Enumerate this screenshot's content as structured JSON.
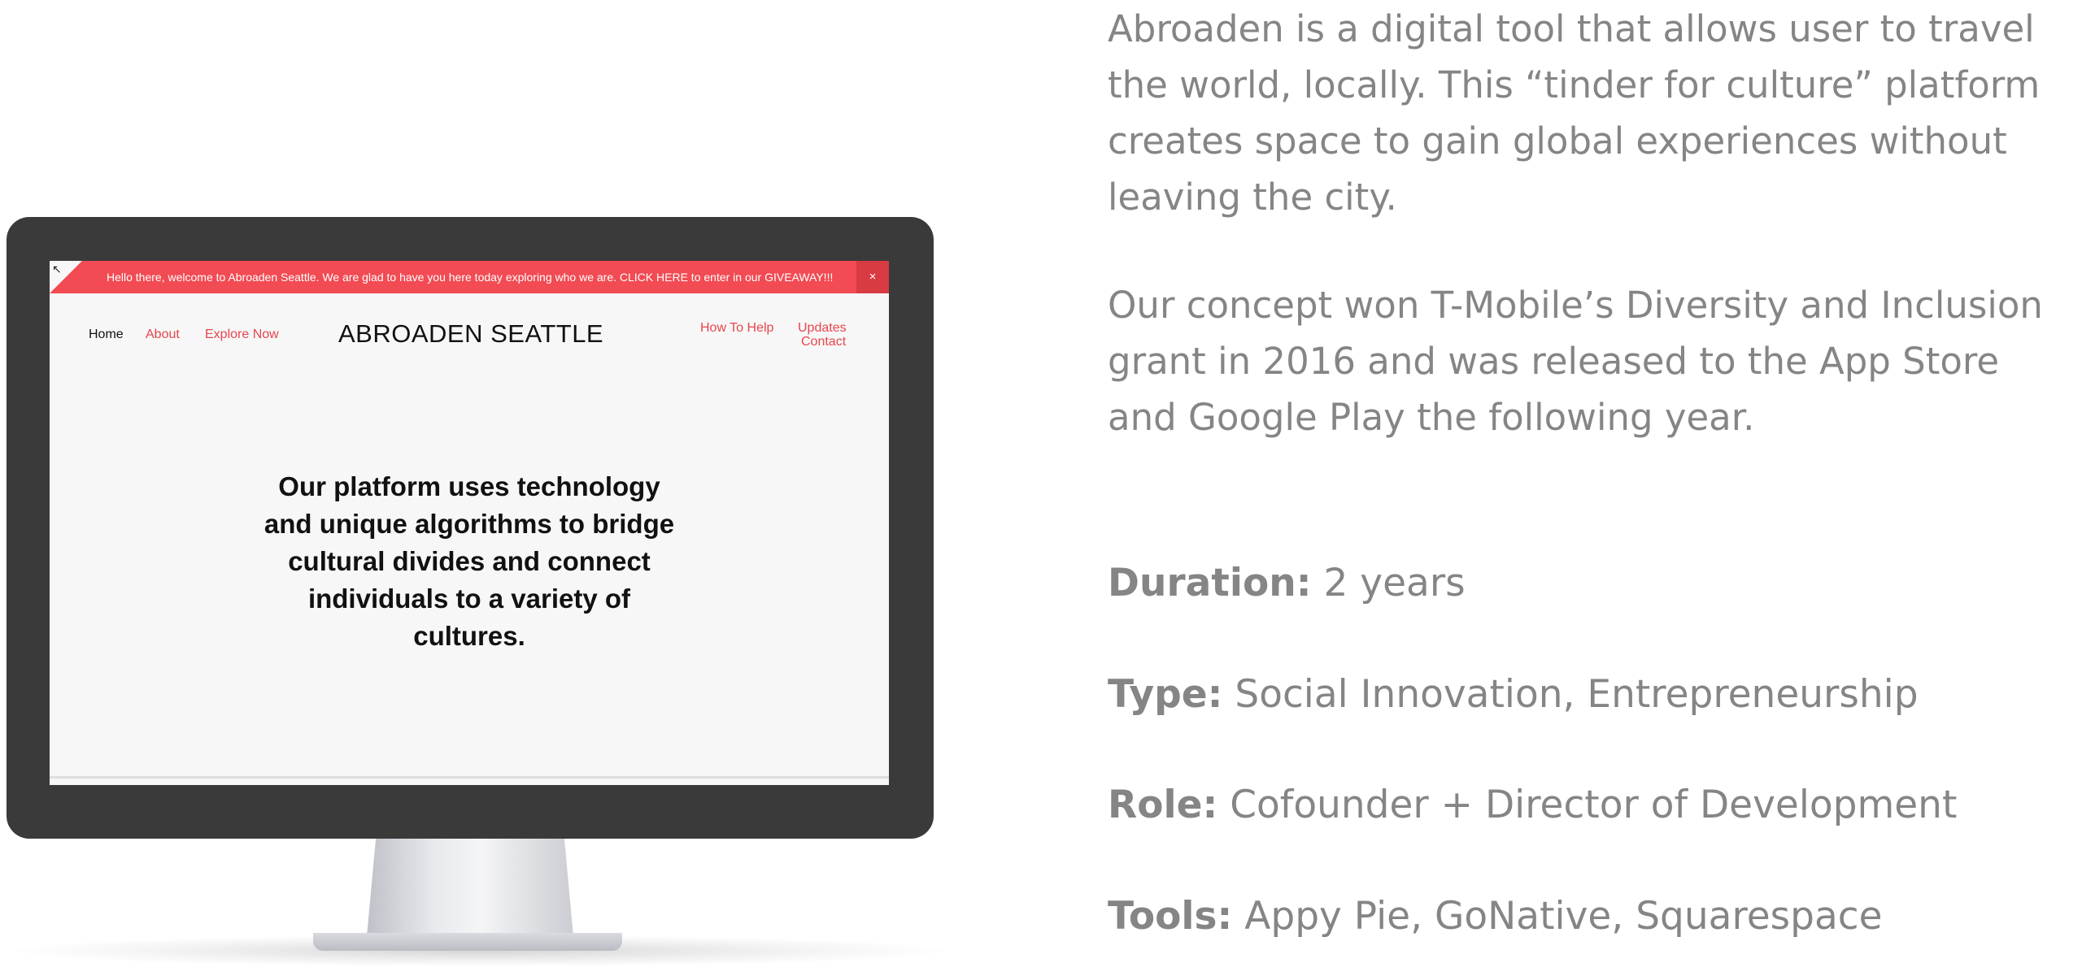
{
  "mockup": {
    "announcement": {
      "text": "Hello there, welcome to Abroaden Seattle. We are glad to have you here today exploring who we are. CLICK HERE to enter in our GIVEAWAY!!!",
      "close_label": "×",
      "corner_icon": "↖"
    },
    "nav": {
      "home": "Home",
      "about": "About",
      "explore": "Explore Now",
      "site_title": "ABROADEN SEATTLE",
      "how_to_help": "How To Help",
      "updates": "Updates",
      "contact": "Contact"
    },
    "hero": {
      "text": "Our platform uses technology and unique algorithms to bridge cultural divides and connect individuals to a variety of cultures."
    },
    "colors": {
      "accent": "#f24b53",
      "monitor_frame": "#3a3a3a",
      "screen_bg": "#f7f7f7"
    }
  },
  "info": {
    "paragraph_1": "Abroaden is a digital tool that allows user to travel the world, locally. This “tinder for culture” platform creates space to gain global experiences without leaving the city.",
    "paragraph_2": "Our concept won T-Mobile’s Diversity and Inclusion grant in 2016 and was released to the App Store and Google Play the following year.",
    "duration_label": "Duration:",
    "duration_value": " 2 years",
    "type_label": "Type:",
    "type_value": " Social Innovation, Entrepreneurship",
    "role_label": "Role:",
    "role_value": " Cofounder + Director of Development",
    "tools_label": "Tools:",
    "tools_value": " Appy Pie, GoNative, Squarespace"
  }
}
